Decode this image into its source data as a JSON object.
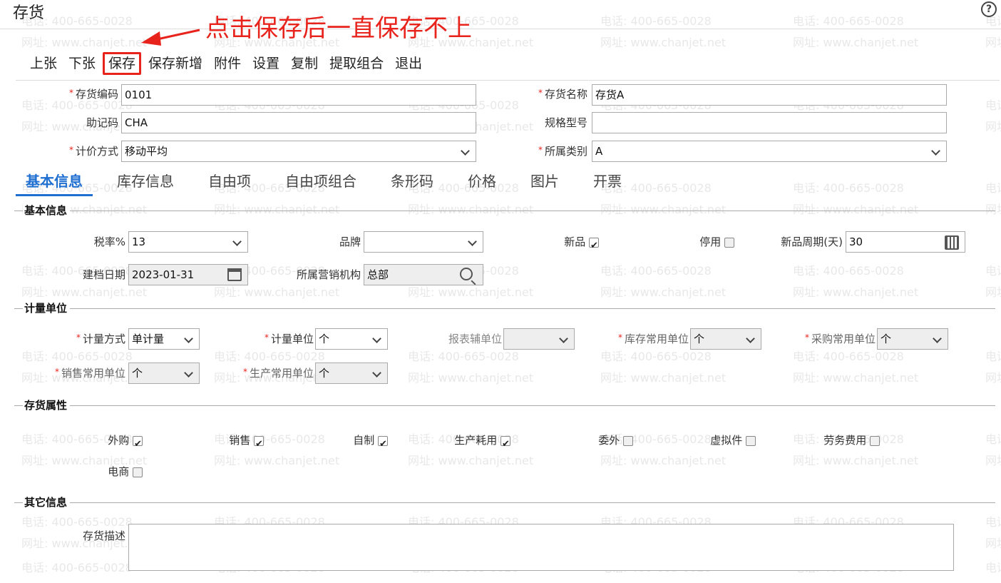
{
  "window": {
    "title": "存货",
    "help_icon": "help-circle-icon"
  },
  "annotation": {
    "text": "点击保存后一直保存不上",
    "color": "#e8231c"
  },
  "toolbar": {
    "prev": "上张",
    "next": "下张",
    "save": "保存",
    "save_new": "保存新增",
    "attach": "附件",
    "settings": "设置",
    "copy": "复制",
    "extract": "提取组合",
    "exit": "退出"
  },
  "header_fields": {
    "code_label": "存货编码",
    "code_value": "0101",
    "name_label": "存货名称",
    "name_value": "存货A",
    "mnemonic_label": "助记码",
    "mnemonic_value": "CHA",
    "spec_label": "规格型号",
    "spec_value": "",
    "pricing_label": "计价方式",
    "pricing_value": "移动平均",
    "category_label": "所属类别",
    "category_value": "A"
  },
  "tabs": [
    "基本信息",
    "库存信息",
    "自由项",
    "自由项组合",
    "条形码",
    "价格",
    "图片",
    "开票"
  ],
  "sections": {
    "basic": "基本信息",
    "unit": "计量单位",
    "attr": "存货属性",
    "other": "其它信息"
  },
  "basic": {
    "tax_label": "税率%",
    "tax_value": "13",
    "brand_label": "品牌",
    "brand_value": "",
    "new_label": "新品",
    "new_checked": true,
    "disabled_label": "停用",
    "disabled_checked": false,
    "cycle_label": "新品周期(天)",
    "cycle_value": "30",
    "date_label": "建档日期",
    "date_value": "2023-01-31",
    "org_label": "所属营销机构",
    "org_value": "总部"
  },
  "unit": {
    "method_label": "计量方式",
    "method_value": "单计量",
    "unit_label": "计量单位",
    "unit_value": "个",
    "report_label": "报表辅单位",
    "report_value": "",
    "stock_label": "库存常用单位",
    "stock_value": "个",
    "purchase_label": "采购常用单位",
    "purchase_value": "个",
    "sales_label": "销售常用单位",
    "sales_value": "个",
    "production_label": "生产常用单位",
    "production_value": "个"
  },
  "attr": {
    "purchased": "外购",
    "sales": "销售",
    "selfmade": "自制",
    "consumed": "生产耗用",
    "outsourced": "委外",
    "virtual": "虚拟件",
    "labor": "劳务费用",
    "ecommerce": "电商"
  },
  "other": {
    "desc_label": "存货描述",
    "desc_value": ""
  },
  "watermark": {
    "phone": "电话: 400-665-0028",
    "site": "网址: www.chanjet.net"
  },
  "colors": {
    "accent": "#1f6fd1",
    "annotation": "#e8231c"
  }
}
